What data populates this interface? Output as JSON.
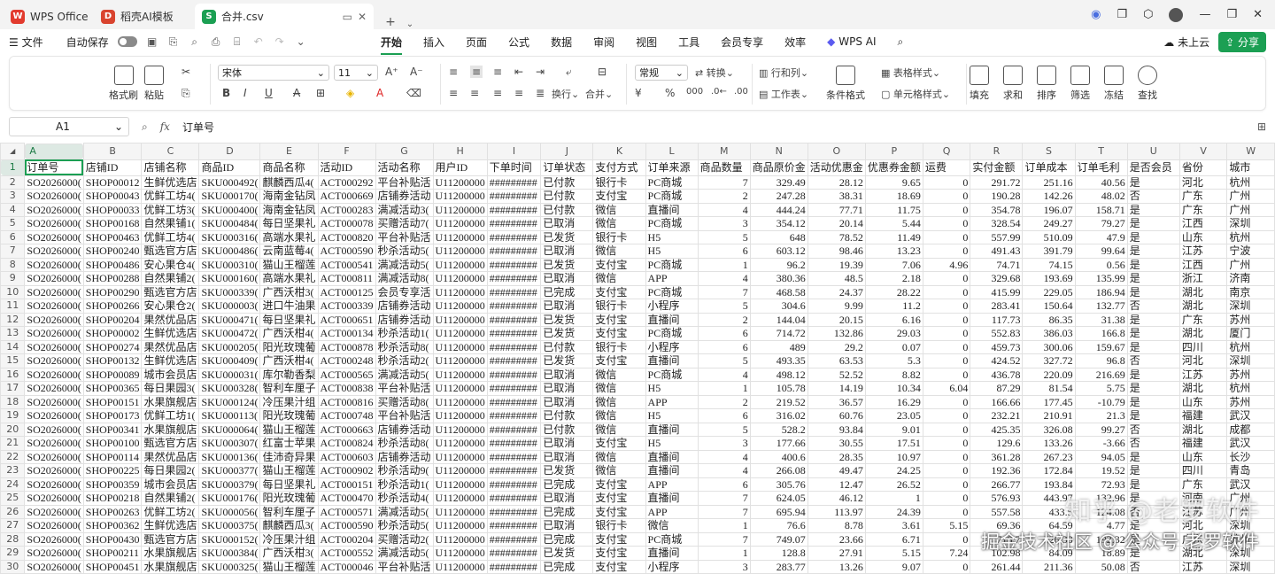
{
  "tabs": [
    {
      "label": "WPS Office"
    },
    {
      "label": "稻壳AI模板"
    },
    {
      "label": "合并.csv"
    }
  ],
  "menu": {
    "file": "文件",
    "autosave": "自动保存",
    "ribbon_tabs": [
      "开始",
      "插入",
      "页面",
      "公式",
      "数据",
      "审阅",
      "视图",
      "工具",
      "会员专享",
      "效率",
      "WPS AI"
    ],
    "cloud": "未上云",
    "share": "分享"
  },
  "toolbar": {
    "format_painter": "格式刷",
    "paste": "粘贴",
    "font": "宋体",
    "size": "11",
    "wrap": "换行",
    "merge": "合并",
    "numfmt": "常规",
    "convert": "转换",
    "rowcol": "行和列",
    "sheet": "工作表",
    "cond": "条件格式",
    "tablestyle": "表格样式",
    "cellstyle": "单元格样式",
    "fill": "填充",
    "sum": "求和",
    "sort": "排序",
    "filter": "筛选",
    "freeze": "冻结",
    "find": "查找"
  },
  "formula": {
    "cell": "A1",
    "value": "订单号"
  },
  "columns": [
    "A",
    "B",
    "C",
    "D",
    "E",
    "F",
    "G",
    "H",
    "I",
    "J",
    "K",
    "L",
    "M",
    "N",
    "O",
    "P",
    "Q",
    "R",
    "S",
    "T",
    "U",
    "V",
    "W"
  ],
  "rows": [
    [
      "订单号",
      "店铺ID",
      "店铺名称",
      "商品ID",
      "商品名称",
      "活动ID",
      "活动名称",
      "用户ID",
      "下单时间",
      "订单状态",
      "支付方式",
      "订单来源",
      "商品数量",
      "商品原价金",
      "活动优惠金",
      "优惠券金额",
      "运费",
      "实付金额",
      "订单成本",
      "订单毛利",
      "是否会员",
      "省份",
      "城市"
    ],
    [
      "SO2026000(",
      "SHOP00012",
      "生鲜优选店",
      "SKU000492(",
      "麒麟西瓜4(",
      "ACT000292",
      "平台补贴活",
      "U11200000",
      "#########",
      "已付款",
      "银行卡",
      "PC商城",
      "7",
      "329.49",
      "28.12",
      "9.65",
      "0",
      "291.72",
      "251.16",
      "40.56",
      "是",
      "河北",
      "杭州"
    ],
    [
      "SO2026000(",
      "SHOP00043",
      "优鲜工坊4(",
      "SKU000170(",
      "海南金钻凤",
      "ACT000669",
      "店铺券活动",
      "U11200000",
      "#########",
      "已付款",
      "支付宝",
      "PC商城",
      "2",
      "247.28",
      "38.31",
      "18.69",
      "0",
      "190.28",
      "142.26",
      "48.02",
      "否",
      "广东",
      "广州"
    ],
    [
      "SO2026000(",
      "SHOP00033",
      "优鲜工坊3(",
      "SKU000400(",
      "海南金钻凤",
      "ACT000283",
      "满减活动3(",
      "U11200000",
      "#########",
      "已付款",
      "微信",
      "直播间",
      "4",
      "444.24",
      "77.71",
      "11.75",
      "0",
      "354.78",
      "196.07",
      "158.71",
      "是",
      "广东",
      "广州"
    ],
    [
      "SO2026000(",
      "SHOP00168",
      "自然果铺1(",
      "SKU000484(",
      "每日坚果礼",
      "ACT000078",
      "买赠活动7(",
      "U11200000",
      "#########",
      "已取消",
      "微信",
      "PC商城",
      "3",
      "354.12",
      "20.14",
      "5.44",
      "0",
      "328.54",
      "249.27",
      "79.27",
      "是",
      "江西",
      "深圳"
    ],
    [
      "SO2026000(",
      "SHOP00463",
      "优鲜工坊4(",
      "SKU000316(",
      "高端水果礼",
      "ACT000820",
      "平台补贴活",
      "U11200000",
      "#########",
      "已发货",
      "银行卡",
      "H5",
      "5",
      "648",
      "78.52",
      "11.49",
      "0",
      "557.99",
      "510.09",
      "47.9",
      "是",
      "山东",
      "杭州"
    ],
    [
      "SO2026000(",
      "SHOP00240",
      "甄选官方店",
      "SKU000486(",
      "云南蓝莓4(",
      "ACT000590",
      "秒杀活动5(",
      "U11200000",
      "#########",
      "已取消",
      "微信",
      "H5",
      "6",
      "603.12",
      "98.46",
      "13.23",
      "0",
      "491.43",
      "391.79",
      "99.64",
      "是",
      "江苏",
      "宁波"
    ],
    [
      "SO2026000(",
      "SHOP00486",
      "安心果仓4(",
      "SKU000310(",
      "猫山王榴莲",
      "ACT000541",
      "满减活动5(",
      "U11200000",
      "#########",
      "已发货",
      "支付宝",
      "PC商城",
      "1",
      "96.2",
      "19.39",
      "7.06",
      "4.96",
      "74.71",
      "74.15",
      "0.56",
      "是",
      "江西",
      "广州"
    ],
    [
      "SO2026000(",
      "SHOP00288",
      "自然果铺2(",
      "SKU000160(",
      "高端水果礼",
      "ACT000811",
      "满减活动8(",
      "U11200000",
      "#########",
      "已取消",
      "微信",
      "APP",
      "4",
      "380.36",
      "48.5",
      "2.18",
      "0",
      "329.68",
      "193.69",
      "135.99",
      "是",
      "浙江",
      "济南"
    ],
    [
      "SO2026000(",
      "SHOP00290",
      "甄选官方店",
      "SKU000339(",
      "广西沃柑3(",
      "ACT000125",
      "会员专享活",
      "U11200000",
      "#########",
      "已完成",
      "支付宝",
      "PC商城",
      "7",
      "468.58",
      "24.37",
      "28.22",
      "0",
      "415.99",
      "229.05",
      "186.94",
      "是",
      "湖北",
      "南京"
    ],
    [
      "SO2026000(",
      "SHOP00266",
      "安心果仓2(",
      "SKU000003(",
      "进口牛油果",
      "ACT000339",
      "店铺券活动",
      "U11200000",
      "#########",
      "已取消",
      "银行卡",
      "小程序",
      "5",
      "304.6",
      "9.99",
      "11.2",
      "0",
      "283.41",
      "150.64",
      "132.77",
      "否",
      "湖北",
      "深圳"
    ],
    [
      "SO2026000(",
      "SHOP00204",
      "果然优品店",
      "SKU000471(",
      "每日坚果礼",
      "ACT000651",
      "店铺券活动",
      "U11200000",
      "#########",
      "已发货",
      "支付宝",
      "直播间",
      "2",
      "144.04",
      "20.15",
      "6.16",
      "0",
      "117.73",
      "86.35",
      "31.38",
      "是",
      "广东",
      "苏州"
    ],
    [
      "SO2026000(",
      "SHOP00002",
      "生鲜优选店",
      "SKU000472(",
      "广西沃柑4(",
      "ACT000134",
      "秒杀活动1(",
      "U11200000",
      "#########",
      "已发货",
      "支付宝",
      "PC商城",
      "6",
      "714.72",
      "132.86",
      "29.03",
      "0",
      "552.83",
      "386.03",
      "166.8",
      "是",
      "湖北",
      "厦门"
    ],
    [
      "SO2026000(",
      "SHOP00274",
      "果然优品店",
      "SKU000205(",
      "阳光玫瑰葡",
      "ACT000878",
      "秒杀活动8(",
      "U11200000",
      "#########",
      "已付款",
      "银行卡",
      "小程序",
      "6",
      "489",
      "29.2",
      "0.07",
      "0",
      "459.73",
      "300.06",
      "159.67",
      "是",
      "四川",
      "杭州"
    ],
    [
      "SO2026000(",
      "SHOP00132",
      "生鲜优选店",
      "SKU000409(",
      "广西沃柑4(",
      "ACT000248",
      "秒杀活动2(",
      "U11200000",
      "#########",
      "已发货",
      "支付宝",
      "直播间",
      "5",
      "493.35",
      "63.53",
      "5.3",
      "0",
      "424.52",
      "327.72",
      "96.8",
      "否",
      "河北",
      "深圳"
    ],
    [
      "SO2026000(",
      "SHOP00089",
      "城市会员店",
      "SKU000031(",
      "库尔勒香梨",
      "ACT000565",
      "满减活动5(",
      "U11200000",
      "#########",
      "已取消",
      "微信",
      "PC商城",
      "4",
      "498.12",
      "52.52",
      "8.82",
      "0",
      "436.78",
      "220.09",
      "216.69",
      "是",
      "江苏",
      "苏州"
    ],
    [
      "SO2026000(",
      "SHOP00365",
      "每日果园3(",
      "SKU000328(",
      "智利车厘子",
      "ACT000838",
      "平台补贴活",
      "U11200000",
      "#########",
      "已取消",
      "微信",
      "H5",
      "1",
      "105.78",
      "14.19",
      "10.34",
      "6.04",
      "87.29",
      "81.54",
      "5.75",
      "是",
      "湖北",
      "杭州"
    ],
    [
      "SO2026000(",
      "SHOP00151",
      "水果旗舰店",
      "SKU000124(",
      "冷压果汁组",
      "ACT000816",
      "买赠活动8(",
      "U11200000",
      "#########",
      "已取消",
      "微信",
      "APP",
      "2",
      "219.52",
      "36.57",
      "16.29",
      "0",
      "166.66",
      "177.45",
      "-10.79",
      "是",
      "山东",
      "苏州"
    ],
    [
      "SO2026000(",
      "SHOP00173",
      "优鲜工坊1(",
      "SKU000113(",
      "阳光玫瑰葡",
      "ACT000748",
      "平台补贴活",
      "U11200000",
      "#########",
      "已付款",
      "微信",
      "H5",
      "6",
      "316.02",
      "60.76",
      "23.05",
      "0",
      "232.21",
      "210.91",
      "21.3",
      "是",
      "福建",
      "武汉"
    ],
    [
      "SO2026000(",
      "SHOP00341",
      "水果旗舰店",
      "SKU000064(",
      "猫山王榴莲",
      "ACT000663",
      "店铺券活动",
      "U11200000",
      "#########",
      "已付款",
      "微信",
      "直播间",
      "5",
      "528.2",
      "93.84",
      "9.01",
      "0",
      "425.35",
      "326.08",
      "99.27",
      "否",
      "湖北",
      "成都"
    ],
    [
      "SO2026000(",
      "SHOP00100",
      "甄选官方店",
      "SKU000307(",
      "红富士苹果",
      "ACT000824",
      "秒杀活动8(",
      "U11200000",
      "#########",
      "已取消",
      "支付宝",
      "H5",
      "3",
      "177.66",
      "30.55",
      "17.51",
      "0",
      "129.6",
      "133.26",
      "-3.66",
      "否",
      "福建",
      "武汉"
    ],
    [
      "SO2026000(",
      "SHOP00114",
      "果然优品店",
      "SKU000136(",
      "佳沛奇异果",
      "ACT000603",
      "店铺券活动",
      "U11200000",
      "#########",
      "已取消",
      "微信",
      "直播间",
      "4",
      "400.6",
      "28.35",
      "10.97",
      "0",
      "361.28",
      "267.23",
      "94.05",
      "是",
      "山东",
      "长沙"
    ],
    [
      "SO2026000(",
      "SHOP00225",
      "每日果园2(",
      "SKU000377(",
      "猫山王榴莲",
      "ACT000902",
      "秒杀活动9(",
      "U11200000",
      "#########",
      "已发货",
      "微信",
      "直播间",
      "4",
      "266.08",
      "49.47",
      "24.25",
      "0",
      "192.36",
      "172.84",
      "19.52",
      "是",
      "四川",
      "青岛"
    ],
    [
      "SO2026000(",
      "SHOP00359",
      "城市会员店",
      "SKU000379(",
      "每日坚果礼",
      "ACT000151",
      "秒杀活动1(",
      "U11200000",
      "#########",
      "已完成",
      "支付宝",
      "APP",
      "6",
      "305.76",
      "12.47",
      "26.52",
      "0",
      "266.77",
      "193.84",
      "72.93",
      "是",
      "广东",
      "武汉"
    ],
    [
      "SO2026000(",
      "SHOP00218",
      "自然果铺2(",
      "SKU000176(",
      "阳光玫瑰葡",
      "ACT000470",
      "秒杀活动4(",
      "U11200000",
      "#########",
      "已取消",
      "支付宝",
      "直播间",
      "7",
      "624.05",
      "46.12",
      "1",
      "0",
      "576.93",
      "443.97",
      "132.96",
      "是",
      "河南",
      "广州"
    ],
    [
      "SO2026000(",
      "SHOP00263",
      "优鲜工坊2(",
      "SKU000056(",
      "智利车厘子",
      "ACT000571",
      "满减活动5(",
      "U11200000",
      "#########",
      "已完成",
      "支付宝",
      "APP",
      "7",
      "695.94",
      "113.97",
      "24.39",
      "0",
      "557.58",
      "433.5",
      "124.08",
      "否",
      "江苏",
      "广州"
    ],
    [
      "SO2026000(",
      "SHOP00362",
      "生鲜优选店",
      "SKU000375(",
      "麒麟西瓜3(",
      "ACT000590",
      "秒杀活动5(",
      "U11200000",
      "#########",
      "已取消",
      "银行卡",
      "微信",
      "1",
      "76.6",
      "8.78",
      "3.61",
      "5.15",
      "69.36",
      "64.59",
      "4.77",
      "是",
      "河北",
      "深圳"
    ],
    [
      "SO2026000(",
      "SHOP00430",
      "甄选官方店",
      "SKU000152(",
      "冷压果汁组",
      "ACT000204",
      "买赠活动2(",
      "U11200000",
      "#########",
      "已完成",
      "支付宝",
      "PC商城",
      "7",
      "749.07",
      "23.66",
      "6.71",
      "0",
      "718.7",
      "526.38",
      "192.32",
      "是",
      "广东",
      "苏州"
    ],
    [
      "SO2026000(",
      "SHOP00211",
      "水果旗舰店",
      "SKU000384(",
      "广西沃柑3(",
      "ACT000552",
      "满减活动5(",
      "U11200000",
      "#########",
      "已发货",
      "支付宝",
      "直播间",
      "1",
      "128.8",
      "27.91",
      "5.15",
      "7.24",
      "102.98",
      "84.09",
      "18.89",
      "是",
      "湖北",
      "深圳"
    ],
    [
      "SO2026000(",
      "SHOP00451",
      "水果旗舰店",
      "SKU000325(",
      "猫山王榴莲",
      "ACT000046",
      "平台补贴活",
      "U11200000",
      "#########",
      "已完成",
      "支付宝",
      "小程序",
      "3",
      "283.77",
      "13.26",
      "9.07",
      "0",
      "261.44",
      "211.36",
      "50.08",
      "否",
      "江苏",
      "深圳"
    ]
  ],
  "watermark": {
    "line1": "知乎 @老罗软件",
    "line2": "掘金技术社区 @ 公众号 老罗软件"
  },
  "colors": {
    "accent": "#1b9f53",
    "wps_red": "#e23b2e",
    "header_bg": "#f5f5f5"
  }
}
